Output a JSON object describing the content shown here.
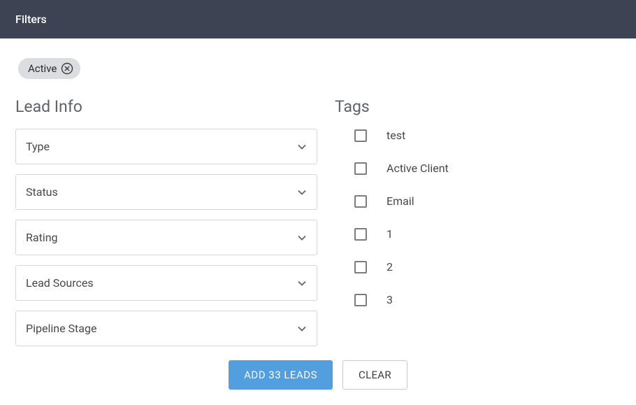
{
  "header": {
    "title": "Filters"
  },
  "chips": [
    {
      "label": "Active"
    }
  ],
  "leadInfo": {
    "title": "Lead Info",
    "dropdowns": [
      {
        "label": "Type"
      },
      {
        "label": "Status"
      },
      {
        "label": "Rating"
      },
      {
        "label": "Lead Sources"
      },
      {
        "label": "Pipeline Stage"
      }
    ]
  },
  "tags": {
    "title": "Tags",
    "items": [
      {
        "label": "test"
      },
      {
        "label": "Active Client"
      },
      {
        "label": "Email"
      },
      {
        "label": "1"
      },
      {
        "label": "2"
      },
      {
        "label": "3"
      }
    ]
  },
  "actions": {
    "primary": "ADD 33 LEADS",
    "secondary": "CLEAR"
  }
}
